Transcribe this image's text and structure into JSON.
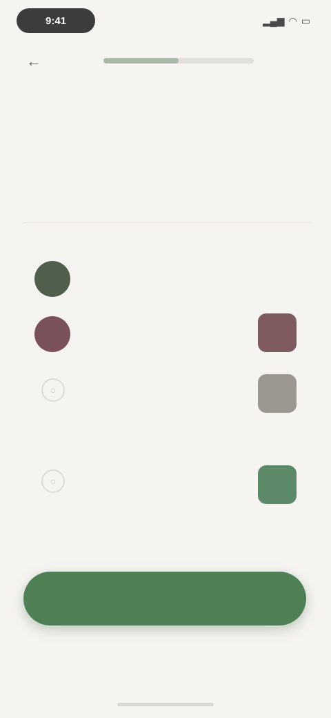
{
  "status": {
    "time": "9:41",
    "icons": [
      "signal-icon",
      "wifi-icon",
      "battery-icon"
    ]
  },
  "nav": {
    "back_icon": "back-arrow-icon",
    "progress": 0.5
  },
  "header": {
    "title": "",
    "subtitle": ""
  },
  "section": {
    "label": ""
  },
  "items": [
    {
      "kind": "avatar",
      "color": "#4f5f4c",
      "title": "",
      "sub": "",
      "meta": ""
    },
    {
      "kind": "avatar",
      "color": "#7a5158",
      "title": "",
      "sub": "",
      "meta": "",
      "thumb_color": "#7d5b5f"
    },
    {
      "kind": "line-icon",
      "title": "",
      "sub": "",
      "meta": "",
      "thumb_color": "#9c9691"
    },
    {
      "kind": "line-icon",
      "title": "",
      "sub": "",
      "meta": "",
      "thumb_color": "#5c8a68"
    }
  ],
  "cta": {
    "label": ""
  },
  "skip": {
    "label": ""
  },
  "colors": {
    "background": "#f6f4f1",
    "accent": "#4f7f55"
  }
}
